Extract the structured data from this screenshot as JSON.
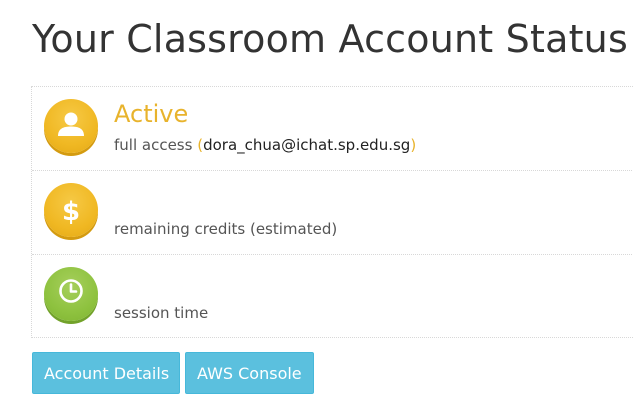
{
  "page": {
    "title": "Your Classroom Account Status"
  },
  "status": {
    "account": {
      "value": "Active",
      "caption": "full access",
      "open_paren": "(",
      "email": "dora_chua@ichat.sp.edu.sg",
      "close_paren": ")",
      "icon": "user-icon"
    },
    "credits": {
      "value": "",
      "caption": "remaining credits (estimated)",
      "icon": "dollar-icon"
    },
    "session": {
      "value": "",
      "caption": "session time",
      "icon": "clock-icon"
    }
  },
  "buttons": {
    "account_details": "Account Details",
    "aws_console": "AWS Console"
  },
  "colors": {
    "accent_yellow": "#e8b32c",
    "badge_yellow": "#f0b823",
    "badge_green": "#8ec23f",
    "button_blue": "#5bc0de",
    "title_text": "#333333"
  }
}
